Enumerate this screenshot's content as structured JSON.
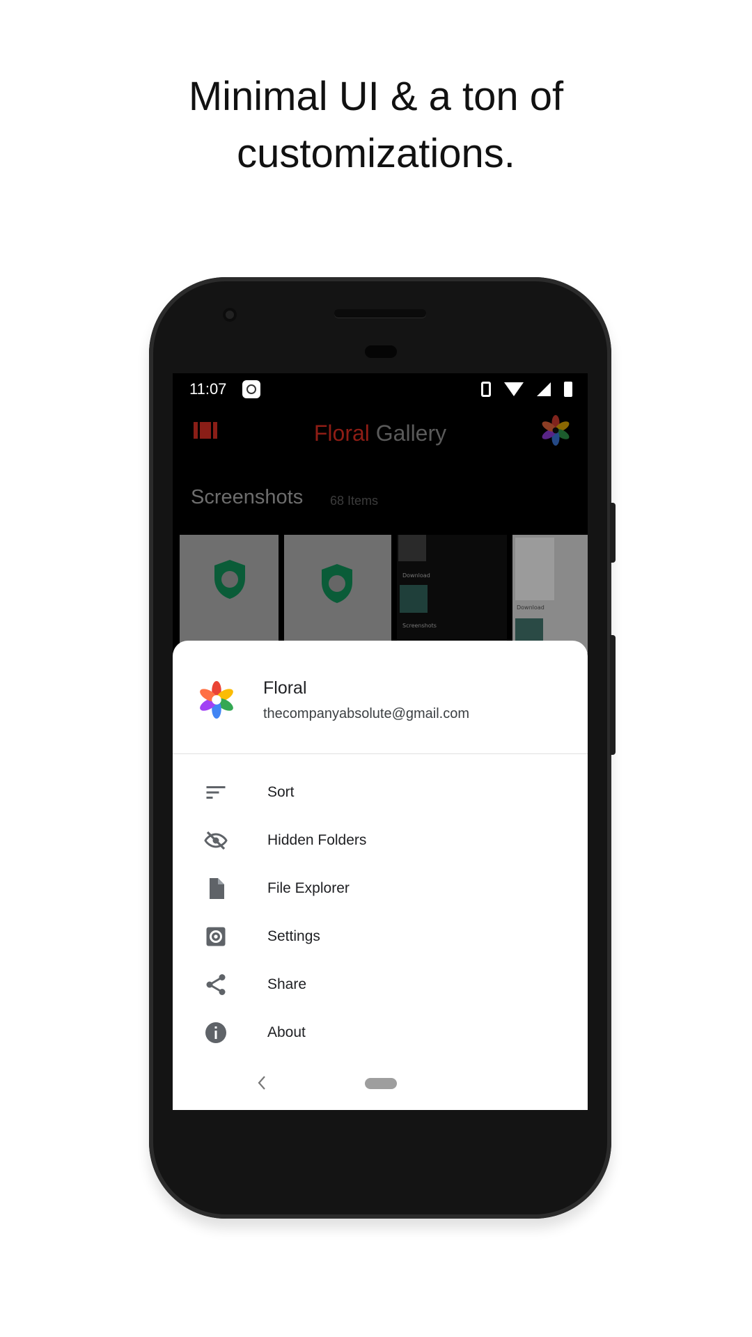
{
  "headline": {
    "line1": "Minimal UI & a ton of",
    "line2": "customizations."
  },
  "status_bar": {
    "time": "11:07",
    "icons": [
      "notification-badge-icon",
      "vibrate-icon",
      "wifi-icon",
      "signal-icon",
      "battery-icon"
    ]
  },
  "app_bar": {
    "title_part1": "Floral",
    "title_part2": "Gallery",
    "title_color_1": "#8e1d15",
    "title_color_2": "#5a5a5a",
    "menu_icon": "film-strip-icon",
    "avatar_icon": "floral-logo-icon"
  },
  "album": {
    "title": "Screenshots",
    "count": "68 Items"
  },
  "thumbnail_text": {
    "download_label": "Download",
    "screenshots_label": "Screenshots"
  },
  "sheet": {
    "account_name": "Floral",
    "account_email": "thecompanyabsolute@gmail.com",
    "items": [
      {
        "label": "Sort",
        "icon": "sort-icon"
      },
      {
        "label": "Hidden Folders",
        "icon": "eye-off-icon"
      },
      {
        "label": "File Explorer",
        "icon": "file-icon"
      },
      {
        "label": "Settings",
        "icon": "settings-icon"
      },
      {
        "label": "Share",
        "icon": "share-icon"
      },
      {
        "label": "About",
        "icon": "info-icon"
      }
    ]
  },
  "colors": {
    "sheet_bg": "#ffffff",
    "screen_bg": "#000000",
    "icon_grey": "#5f6368",
    "shield_green": "#0d8a55"
  }
}
